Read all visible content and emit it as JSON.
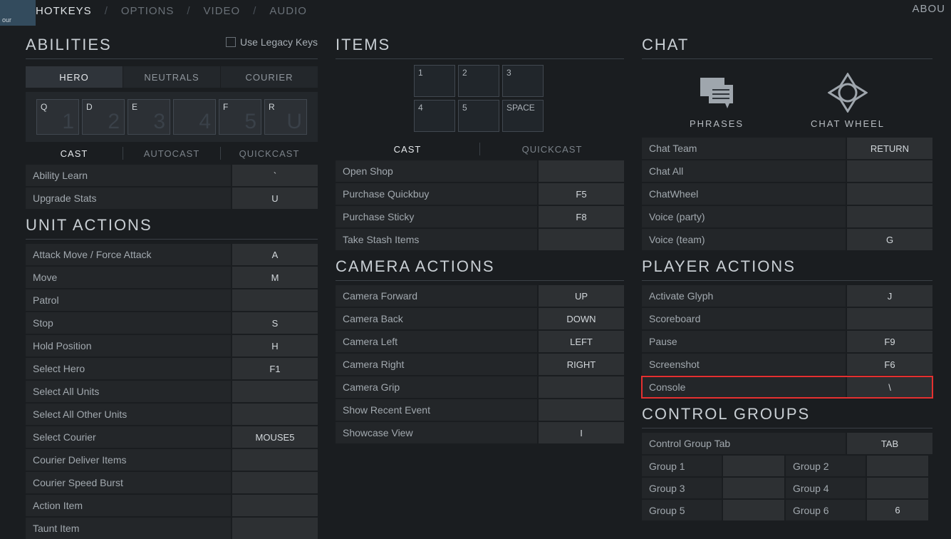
{
  "topnav": {
    "items": [
      "HOTKEYS",
      "OPTIONS",
      "VIDEO",
      "AUDIO"
    ],
    "activeIndex": 0,
    "about": "ABOU",
    "corner": "our"
  },
  "abilities": {
    "title": "ABILITIES",
    "legacy": "Use Legacy Keys",
    "tabs": [
      "HERO",
      "NEUTRALS",
      "COURIER"
    ],
    "activeTab": 0,
    "slots": [
      {
        "key": "Q",
        "big": "1"
      },
      {
        "key": "D",
        "big": "2"
      },
      {
        "key": "E",
        "big": "3"
      },
      {
        "key": "",
        "big": "4"
      },
      {
        "key": "F",
        "big": "5"
      },
      {
        "key": "R",
        "big": "U"
      }
    ],
    "castTabs": [
      "CAST",
      "AUTOCAST",
      "QUICKCAST"
    ],
    "activeCast": 0,
    "rows": [
      {
        "label": "Ability Learn",
        "key": "`"
      },
      {
        "label": "Upgrade Stats",
        "key": "U"
      }
    ]
  },
  "unitActions": {
    "title": "UNIT ACTIONS",
    "rows": [
      {
        "label": "Attack Move / Force Attack",
        "key": "A"
      },
      {
        "label": "Move",
        "key": "M"
      },
      {
        "label": "Patrol",
        "key": ""
      },
      {
        "label": "Stop",
        "key": "S"
      },
      {
        "label": "Hold Position",
        "key": "H"
      },
      {
        "label": "Select Hero",
        "key": "F1"
      },
      {
        "label": "Select All Units",
        "key": ""
      },
      {
        "label": "Select All Other Units",
        "key": ""
      },
      {
        "label": "Select Courier",
        "key": "MOUSE5"
      },
      {
        "label": "Courier Deliver Items",
        "key": ""
      },
      {
        "label": "Courier Speed Burst",
        "key": ""
      },
      {
        "label": "Action Item",
        "key": ""
      },
      {
        "label": "Taunt Item",
        "key": ""
      }
    ]
  },
  "items": {
    "title": "ITEMS",
    "row1": [
      {
        "key": "1"
      },
      {
        "key": "2"
      },
      {
        "key": "3"
      }
    ],
    "row2": [
      {
        "key": "4"
      },
      {
        "key": "5"
      },
      {
        "key": "SPACE"
      }
    ],
    "castTabs": [
      "CAST",
      "QUICKCAST"
    ],
    "activeCast": 0,
    "rows": [
      {
        "label": "Open Shop",
        "key": ""
      },
      {
        "label": "Purchase Quickbuy",
        "key": "F5"
      },
      {
        "label": "Purchase Sticky",
        "key": "F8"
      },
      {
        "label": "Take Stash Items",
        "key": ""
      }
    ]
  },
  "camera": {
    "title": "CAMERA ACTIONS",
    "rows": [
      {
        "label": "Camera Forward",
        "key": "UP"
      },
      {
        "label": "Camera Back",
        "key": "DOWN"
      },
      {
        "label": "Camera Left",
        "key": "LEFT"
      },
      {
        "label": "Camera Right",
        "key": "RIGHT"
      },
      {
        "label": "Camera Grip",
        "key": ""
      },
      {
        "label": "Show Recent Event",
        "key": ""
      },
      {
        "label": "Showcase View",
        "key": "I"
      }
    ]
  },
  "chat": {
    "title": "CHAT",
    "phrasesLabel": "PHRASES",
    "wheelLabel": "CHAT WHEEL",
    "rows": [
      {
        "label": "Chat Team",
        "key": "RETURN"
      },
      {
        "label": "Chat All",
        "key": ""
      },
      {
        "label": "ChatWheel",
        "key": ""
      },
      {
        "label": "Voice (party)",
        "key": ""
      },
      {
        "label": "Voice (team)",
        "key": "G"
      }
    ]
  },
  "playerActions": {
    "title": "PLAYER ACTIONS",
    "rows": [
      {
        "label": "Activate Glyph",
        "key": "J",
        "highlight": false
      },
      {
        "label": "Scoreboard",
        "key": "",
        "highlight": false
      },
      {
        "label": "Pause",
        "key": "F9",
        "highlight": false
      },
      {
        "label": "Screenshot",
        "key": "F6",
        "highlight": false
      },
      {
        "label": "Console",
        "key": "\\",
        "highlight": true
      }
    ]
  },
  "controlGroups": {
    "title": "CONTROL GROUPS",
    "tabRow": {
      "label": "Control Group Tab",
      "key": "TAB"
    },
    "groups": [
      [
        {
          "label": "Group 1",
          "key": ""
        },
        {
          "label": "Group 2",
          "key": ""
        }
      ],
      [
        {
          "label": "Group 3",
          "key": ""
        },
        {
          "label": "Group 4",
          "key": ""
        }
      ],
      [
        {
          "label": "Group 5",
          "key": ""
        },
        {
          "label": "Group 6",
          "key": "6"
        }
      ]
    ]
  }
}
